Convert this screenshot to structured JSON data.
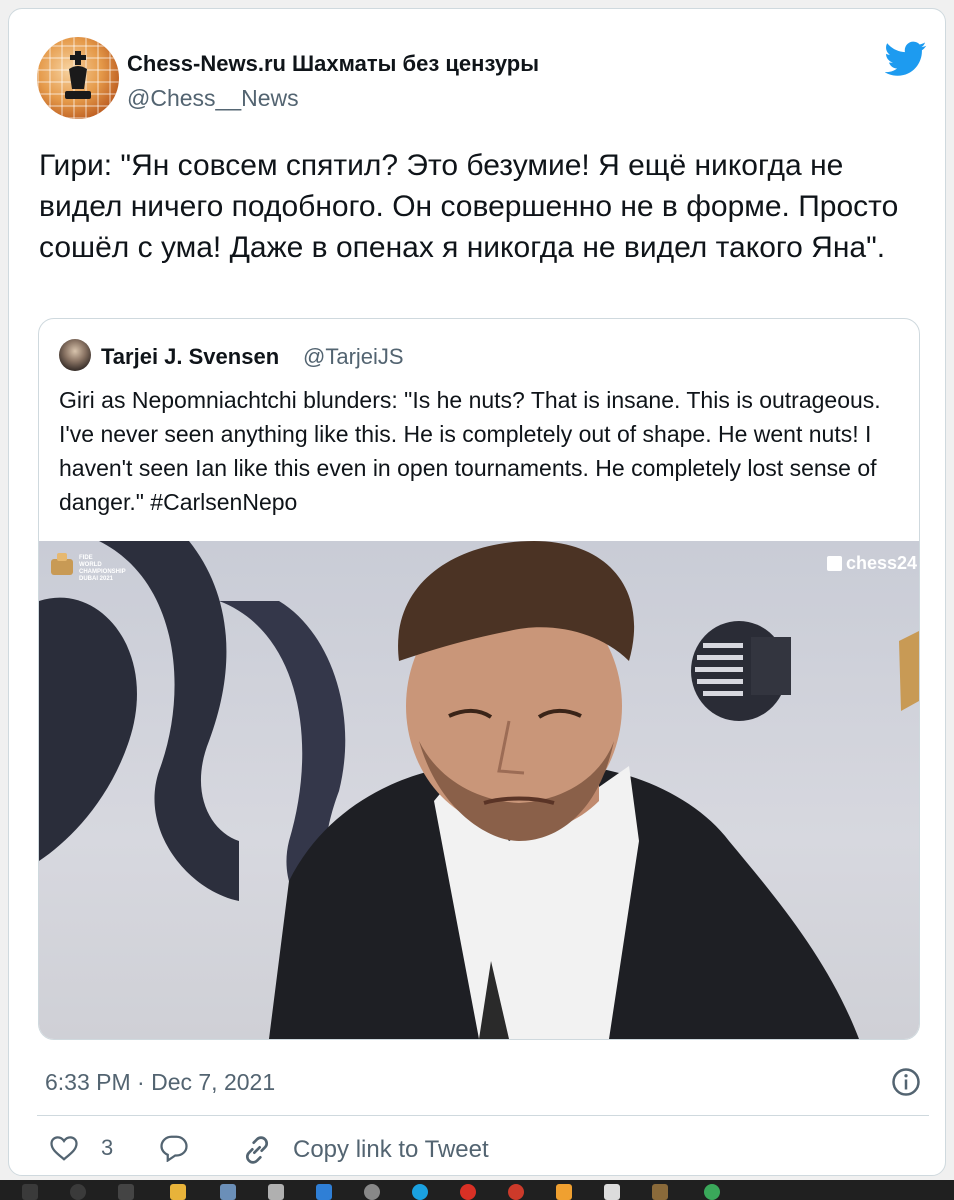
{
  "author": {
    "name": "Chess-News.ru Шахматы без цензуры",
    "handle": "@Chess__News"
  },
  "tweet": {
    "text": "Гири: \"Ян совсем спятил? Это безумие! Я ещё никогда не видел ничего подобного. Он совершенно не в форме. Просто сошёл с ума! Даже в опенах я никогда не видел такого Яна\"."
  },
  "quote": {
    "name": "Tarjei J. Svensen",
    "handle": "@TarjeiJS",
    "text": "Giri as Nepomniachtchi blunders: \"Is he nuts? That is insane. This is outrageous. I've never seen anything like this. He is completely out of shape. He went nuts! I haven't seen Ian like this even in open tournaments. He completely lost sense of danger.\"  ",
    "hashtag": "#CarlsenNepo",
    "media": {
      "fide_logo_text": [
        "FIDE",
        "WORLD",
        "CHAMPIONSHIP",
        "DUBAI 2021"
      ],
      "watermark": "chess24"
    }
  },
  "meta": {
    "timestamp": "6:33 PM · Dec 7, 2021"
  },
  "actions": {
    "like_count": "3",
    "copy_link_label": "Copy link to Tweet"
  },
  "icons": {
    "brand": "twitter-bird-icon",
    "info": "info-icon",
    "like": "heart-icon",
    "reply": "speech-bubble-icon",
    "copy": "link-icon"
  },
  "colors": {
    "twitter_blue": "#1d9bf0",
    "secondary_text": "#536471",
    "border": "#cfd9de"
  }
}
